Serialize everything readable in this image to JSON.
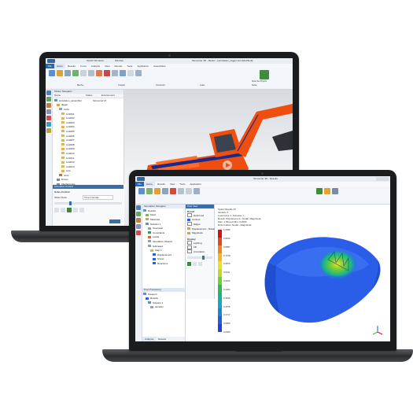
{
  "laptop1": {
    "title_left": "Switch Windows",
    "title_mid": "Window",
    "title_right": "Simcenter 3D - Motion - [simulation_trigger.sim (Modified)]",
    "ribbon_tabs": [
      "File",
      "Home",
      "Results",
      "Curve",
      "Analysis",
      "View",
      "Render",
      "Tools",
      "Application",
      "Assemblies"
    ],
    "ribbon_groups": [
      "Mecha",
      "Coupler",
      "Connector",
      "Load",
      "Solve"
    ],
    "ribbon_solve_label": "Solve Set Physics",
    "nav_title": "Motion Navigator",
    "nav_headers": [
      "Name",
      "Status",
      "Environment"
    ],
    "nav_root": "simulation_assembler",
    "nav_env": "Simcenter M",
    "nav_items": [
      "digger",
      "Links",
      "Link001",
      "Link002",
      "Link003",
      "Link004",
      "Link005",
      "Link006",
      "Link007",
      "Link008",
      "Link009",
      "Link010",
      "Link011",
      "Link012",
      "Link013",
      "Link",
      "Joint",
      "Drives",
      "Interferences",
      "Measure"
    ],
    "panel_title": "Animation Control",
    "panel_section": "Solve Control",
    "panel_label": "Slider Mode",
    "panel_select": "Time Intervals",
    "colors": {
      "ribbon": "#f2f5f9",
      "tab_bar": "#2f66a8",
      "excavator": "#ee4e10",
      "dark_blue": "#1a2a8c"
    }
  },
  "laptop2": {
    "title": "Simcenter 3D - Results",
    "ribbon_tabs": [
      "File",
      "Home",
      "Results",
      "View",
      "Tools",
      "Application"
    ],
    "left_panel_title": "Simulation Navigator",
    "left_tree": [
      "Results",
      "Mesh",
      "Materials",
      "Solution 1",
      "Structural",
      "Constraints",
      "Loads",
      "Simulation Objects",
      "Subcases",
      "Step 1",
      "Displacement",
      "Stress",
      "Reactions"
    ],
    "left_tree2_title": "Post Processing",
    "left_tree2": [
      "Viewport",
      "Results",
      "Solution 1",
      "Iteration"
    ],
    "mid_panel_title": "Post View",
    "mid_rows": [
      "Deformed",
      "Contour",
      "Edges",
      "Displacement - Nodal",
      "Magnitude",
      "Lighting",
      "Fill",
      "Annotation"
    ],
    "mid_label1": "Result",
    "mid_label2": "Display",
    "result_header": [
      "Spark Results 20",
      "Iteration 1",
      "Load Case 1, Subcase 1",
      "Result: Displacement - Nodal, Magnitude",
      "Max: 1.031e+0 Min: 0.0000",
      "Deformation: Nodal - Magnitude"
    ],
    "legend_ticks": [
      "1.0305",
      "0.9446",
      "0.8587",
      "0.7728",
      "0.6870",
      "0.6011",
      "0.5152",
      "0.4293",
      "0.3435",
      "0.2576",
      "0.1717",
      "0.0859",
      "0.0000"
    ],
    "legend_colors": [
      "#d0141a",
      "#e8471b",
      "#f3811c",
      "#f6b820",
      "#eddf2a",
      "#b9de2a",
      "#6fd034",
      "#2bbd54",
      "#17b38f",
      "#15a5c5",
      "#1a83df",
      "#1d5ee5",
      "#2142d6"
    ],
    "model_color": "#2b5ee8",
    "bottom_tabs": [
      "Analysis",
      "Results"
    ],
    "triad_labels": [
      "X",
      "Y",
      "Z"
    ]
  }
}
